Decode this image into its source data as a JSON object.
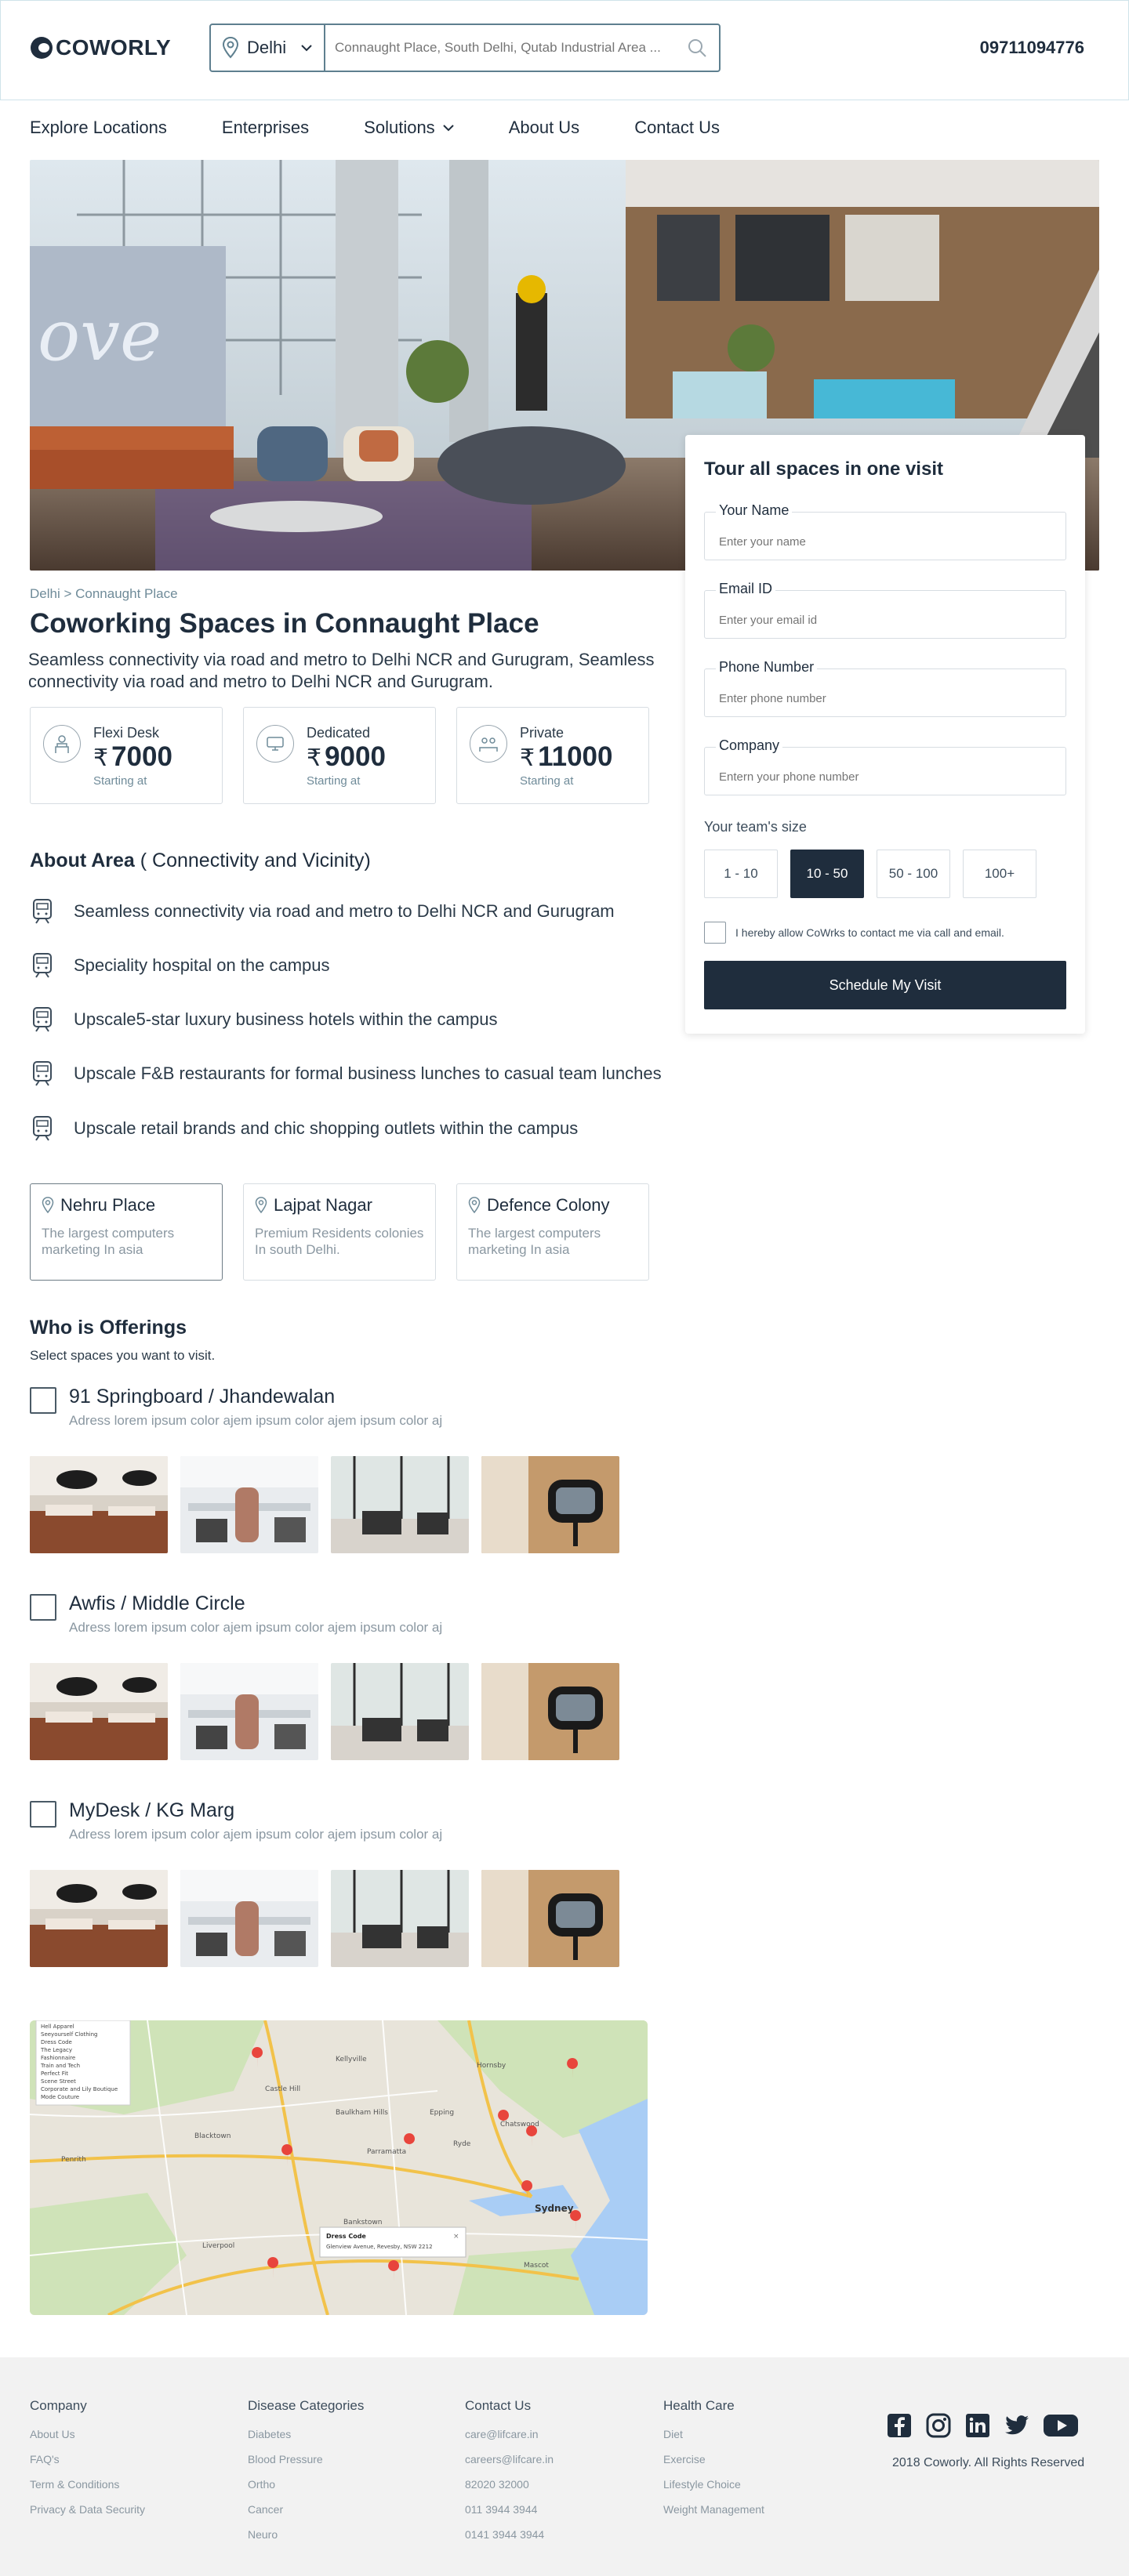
{
  "header": {
    "logo_text": "COWORLY",
    "city": "Delhi",
    "search_placeholder": "Connaught Place, South Delhi, Qutab Industrial Area ...",
    "phone": "09711094776"
  },
  "nav": {
    "items": [
      "Explore Locations",
      "Enterprises",
      "Solutions",
      "About Us",
      "Contact Us"
    ]
  },
  "form": {
    "title": "Tour all spaces in one visit",
    "name_label": "Your Name",
    "name_placeholder": "Enter your name",
    "email_label": "Email ID",
    "email_placeholder": "Enter your email id",
    "phone_label": "Phone Number",
    "phone_placeholder": "Enter phone number",
    "company_label": "Company",
    "company_placeholder": "Entern your phone number",
    "team_label": "Your team's size",
    "team_sizes": [
      "1 - 10",
      "10 - 50",
      "50 - 100",
      "100+"
    ],
    "team_selected": "10 - 50",
    "consent": "I hereby allow CoWrks to contact me via call and email.",
    "submit": "Schedule My Visit"
  },
  "listing": {
    "breadcrumb": "Delhi > Connaught Place",
    "title": "Coworking Spaces in Connaught Place",
    "description": "Seamless connectivity via road and metro to Delhi NCR and Gurugram, Seamless connectivity via road and metro to Delhi NCR and Gurugram.",
    "prices": [
      {
        "name": "Flexi Desk",
        "value": "7000",
        "sub": "Starting at"
      },
      {
        "name": "Dedicated",
        "value": "9000",
        "sub": "Starting at"
      },
      {
        "name": "Private",
        "value": "11000",
        "sub": "Starting at"
      }
    ],
    "currency_symbol": "₹"
  },
  "about": {
    "title": "About Area",
    "title_suffix": "( Connectivity and Vicinity)",
    "items": [
      "Seamless connectivity via road and metro to Delhi NCR and Gurugram",
      "Speciality hospital on the campus",
      "Upscale5-star luxury business hotels within the campus",
      "Upscale F&B restaurants for formal business lunches to casual team lunches",
      "Upscale retail brands and chic shopping outlets within the campus"
    ]
  },
  "locations": [
    {
      "name": "Nehru Place",
      "desc": "The largest computers marketing In asia"
    },
    {
      "name": "Lajpat Nagar",
      "desc": "Premium Residents colonies In south Delhi."
    },
    {
      "name": "Defence Colony",
      "desc": "The largest computers marketing In asia"
    }
  ],
  "offerings": {
    "title": "Who is Offerings",
    "subtitle": "Select spaces you want to visit.",
    "items": [
      {
        "name": "91 Springboard / Jhandewalan",
        "address": "Adress lorem ipsum color ajem ipsum color ajem ipsum color aj"
      },
      {
        "name": "Awfis / Middle Circle",
        "address": "Adress lorem ipsum color ajem ipsum color ajem ipsum color aj"
      },
      {
        "name": "MyDesk / KG Marg",
        "address": "Adress lorem ipsum color ajem ipsum color ajem ipsum color aj"
      }
    ]
  },
  "map": {
    "popup_title": "Dress Code",
    "popup_address": "Glenview Avenue, Revesby, NSW 2212",
    "list": [
      "Hell Apparel",
      "Seeyourself Clothing",
      "Dress Code",
      "The Legacy",
      "Fashionnaire",
      "Train and Tech",
      "Perfect Fit",
      "Scene Street",
      "Corporate and Lily Boutique",
      "Mode Couture"
    ],
    "city_label": "Sydney",
    "places": [
      "Kellyville",
      "Castle Hill",
      "Baulkham Hills",
      "Ryde",
      "Parramatta",
      "Chatswood",
      "Hornsby",
      "Liverpool",
      "Mascot",
      "Penrith",
      "Epping",
      "Bankstown",
      "Blacktown"
    ]
  },
  "footer": {
    "columns": [
      {
        "title": "Company",
        "links": [
          "About Us",
          "FAQ's",
          "Term & Conditions",
          "Privacy & Data Security"
        ]
      },
      {
        "title": "Disease Categories",
        "links": [
          "Diabetes",
          "Blood Pressure",
          "Ortho",
          "Cancer",
          "Neuro"
        ]
      },
      {
        "title": "Contact Us",
        "links": [
          "care@lifcare.in",
          "careers@lifcare.in",
          "82020 32000",
          "011 3944 3944",
          "0141 3944 3944"
        ]
      },
      {
        "title": "Health Care",
        "links": [
          "Diet",
          "Exercise",
          "Lifestyle Choice",
          "Weight Management"
        ]
      }
    ],
    "socials": [
      "facebook-icon",
      "instagram-icon",
      "linkedin-icon",
      "twitter-icon",
      "youtube-icon"
    ],
    "copyright": "2018 Coworly. All Rights Reserved"
  },
  "colors": {
    "primary": "#1f2d3d",
    "accent_border": "#5e7f8f",
    "muted_text": "#8a97a1",
    "map_pin": "#e8453c"
  }
}
